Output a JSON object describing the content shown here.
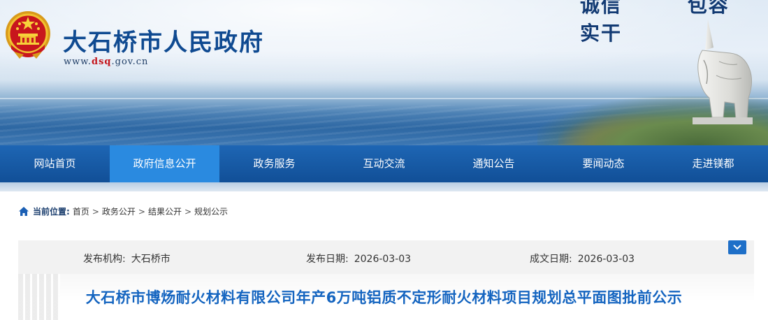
{
  "header": {
    "site_title": "大石桥市人民政府",
    "url_prefix": "www.",
    "url_highlight": "dsq",
    "url_suffix": ".gov.cn",
    "slogan": [
      "诚信",
      "包容",
      "实干"
    ]
  },
  "nav": {
    "items": [
      {
        "label": "网站首页"
      },
      {
        "label": "政府信息公开",
        "active": true
      },
      {
        "label": "政务服务"
      },
      {
        "label": "互动交流"
      },
      {
        "label": "通知公告"
      },
      {
        "label": "要闻动态"
      },
      {
        "label": "走进镁都"
      }
    ]
  },
  "breadcrumb": {
    "label": "当前位置:",
    "items": [
      "首页",
      "政务公开",
      "结果公开",
      "规划公示"
    ],
    "separator": ">"
  },
  "meta": {
    "publisher_label": "发布机构:",
    "publisher_value": "大石桥市",
    "publish_date_label": "发布日期:",
    "publish_date_value": "2026-03-03",
    "written_date_label": "成文日期:",
    "written_date_value": "2026-03-03"
  },
  "document": {
    "title": "大石桥市博炀耐火材料有限公司年产6万吨铝质不定形耐火材料项目规划总平面图批前公示"
  },
  "colors": {
    "brand_blue": "#0f4a91",
    "nav_bg": "#114f97",
    "nav_active": "#2a8ae0",
    "title_blue": "#1565c0",
    "url_red": "#c4161c"
  },
  "icons": {
    "emblem": "national-emblem",
    "home": "home-icon",
    "expand": "chevron-down-icon"
  }
}
